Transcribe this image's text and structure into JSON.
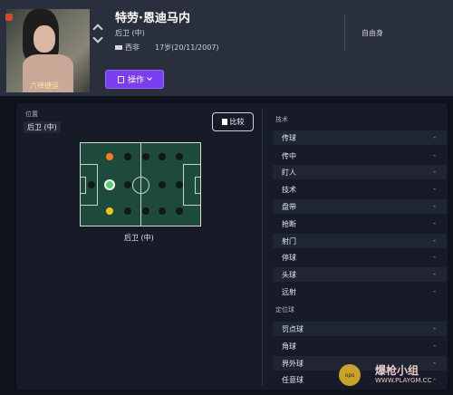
{
  "player": {
    "name": "特劳·恩迪马内",
    "position": "后卫 (中)",
    "nationality": "西非",
    "age": "17岁(20/11/2007)",
    "status": "自由身",
    "photo_watermark": "六禅捷运"
  },
  "actions": {
    "operate_label": "操作",
    "compare_label": "比较"
  },
  "position_panel": {
    "title": "位置",
    "current": "后卫 (中)",
    "pitch_caption": "后卫 (中)"
  },
  "pitch_positions": [
    {
      "id": "gk",
      "state": "inactive"
    },
    {
      "id": "dl",
      "state": "orange"
    },
    {
      "id": "dc",
      "state": "selected"
    },
    {
      "id": "dr",
      "state": "yellow"
    }
  ],
  "attributes": {
    "technical_title": "技术",
    "technical": [
      {
        "label": "传球",
        "value": "-"
      },
      {
        "label": "传中",
        "value": "-"
      },
      {
        "label": "盯人",
        "value": "-"
      },
      {
        "label": "技术",
        "value": "-"
      },
      {
        "label": "盘带",
        "value": "-"
      },
      {
        "label": "抢断",
        "value": "-"
      },
      {
        "label": "射门",
        "value": "-"
      },
      {
        "label": "停球",
        "value": "-"
      },
      {
        "label": "头球",
        "value": "-"
      },
      {
        "label": "远射",
        "value": "-"
      }
    ],
    "set_piece_title": "定位球",
    "set_piece": [
      {
        "label": "罚点球",
        "value": "-"
      },
      {
        "label": "角球",
        "value": "-"
      },
      {
        "label": "界外球",
        "value": "-"
      },
      {
        "label": "任意球",
        "value": "-"
      }
    ]
  },
  "watermark": {
    "brand": "爆枪小组",
    "url": "WWW.PLAYGM.CC",
    "badge": "ops"
  },
  "colors": {
    "accent": "#7a3df0",
    "pitch": "#1d4a3a",
    "selected_position": "#4fd16a",
    "orange_position": "#ff7a1a",
    "yellow_position": "#f3c21b"
  }
}
